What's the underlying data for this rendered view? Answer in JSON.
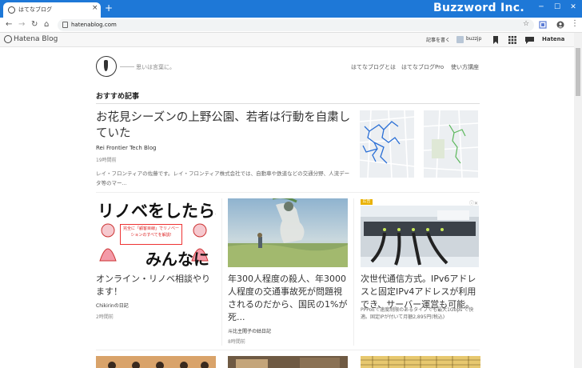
{
  "browser": {
    "tab_title": "はてなブログ",
    "new_tab_symbol": "+",
    "close_symbol": "×",
    "watermark": "Buzzword Inc.",
    "window": {
      "minimize": "─",
      "maximize": "☐",
      "close": "✕"
    },
    "url": "hatenablog.com"
  },
  "hatena_bar": {
    "logo_text": "Hatena Blog",
    "write_article": "記事を書く",
    "user": "buzzjp",
    "brand": "Hatena"
  },
  "site": {
    "tagline": "思いは言葉に。",
    "nav": [
      "はてなブログとは",
      "はてなブログPro",
      "使い方講座"
    ]
  },
  "section_title": "おすすめ記事",
  "featured": {
    "title": "お花見シーズンの上野公園、若者は行動を自粛していた",
    "blog": "Rei Frontier Tech Blog",
    "time": "19時間前",
    "description": "レイ・フロンティアの佐藤です。レイ・フロンティア株式会社では、自動車や鉄道などの交通分野、人流データ等のマー..."
  },
  "cards": [
    {
      "image_text_top": "リノベをしたら、",
      "image_text_bottom": "みんなに",
      "image_caption": "完全に「顧客目線」でリノベーションのすべてを解説!",
      "title": "オンライン・リノベ相談やります！",
      "blog": "Chikirinの日記",
      "time": "2時間前"
    },
    {
      "title": "年300人程度の殺人、年3000人程度の交通事故死が問題視されるのだから、国民の1%が死...",
      "blog": "斗比主閲子の姑日記",
      "time": "8時間前"
    },
    {
      "ad_badge": "広告",
      "ad_close": "ⓘ✕",
      "title": "次世代通信方式。IPv6アドレスと固定IPv4アドレスが利用でき、サーバー運営も可能。",
      "description": "PPPoEで速度制限のあるタイプでも最大1Gbps で快適。固定IPが付いて月額2,895円(税込)"
    }
  ],
  "colors": {
    "chrome_blue": "#1e78d7",
    "ad_badge": "#e9b100",
    "map_route_blue": "#2a6fd6",
    "map_route_green": "#5cb85c"
  }
}
